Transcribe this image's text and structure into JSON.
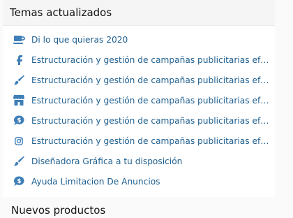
{
  "widget": {
    "title": "Temas actualizados",
    "accent_color": "#3f7fb8",
    "link_color": "#1f5f8f",
    "items": [
      {
        "icon": "coffee-cup-icon",
        "label": "Di lo que quieras 2020"
      },
      {
        "icon": "facebook-icon",
        "label": "Estructuración y gestión de campañas publicitarias efe..."
      },
      {
        "icon": "paintbrush-icon",
        "label": "Estructuración y gestión de campañas publicitarias efe..."
      },
      {
        "icon": "storefront-icon",
        "label": "Estructuración y gestión de campañas publicitarias efe..."
      },
      {
        "icon": "dollar-bubble-icon",
        "label": "Estructuración y gestión de campañas publicitarias efe..."
      },
      {
        "icon": "instagram-icon",
        "label": "Estructuración y gestión de campañas publicitarias efe..."
      },
      {
        "icon": "paintbrush-icon",
        "label": "Diseñadora Gráfica a tu disposición"
      },
      {
        "icon": "dollar-bubble-icon",
        "label": "Ayuda Limitacion De Anuncios"
      }
    ]
  },
  "next_section": {
    "title": "Nuevos productos"
  }
}
